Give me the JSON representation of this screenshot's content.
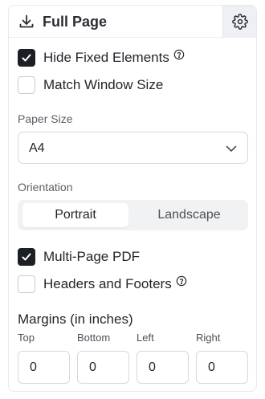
{
  "header": {
    "title": "Full Page",
    "download_icon": "download-icon",
    "settings_icon": "gear-icon"
  },
  "options": {
    "hide_fixed": {
      "label": "Hide Fixed Elements",
      "checked": true
    },
    "match_window": {
      "label": "Match Window Size",
      "checked": false
    }
  },
  "paper_size": {
    "label": "Paper Size",
    "value": "A4"
  },
  "orientation": {
    "label": "Orientation",
    "options": [
      "Portrait",
      "Landscape"
    ],
    "selected": "Portrait"
  },
  "pdf_options": {
    "multi_page": {
      "label": "Multi-Page PDF",
      "checked": true
    },
    "headers_footers": {
      "label": "Headers and Footers",
      "checked": false
    }
  },
  "margins": {
    "title": "Margins (in inches)",
    "fields": [
      {
        "label": "Top",
        "value": "0"
      },
      {
        "label": "Bottom",
        "value": "0"
      },
      {
        "label": "Left",
        "value": "0"
      },
      {
        "label": "Right",
        "value": "0"
      }
    ]
  },
  "colors": {
    "checkbox_checked": "#1c1f24",
    "border": "#d5d8dd",
    "segment_bg": "#f1f2f4"
  }
}
